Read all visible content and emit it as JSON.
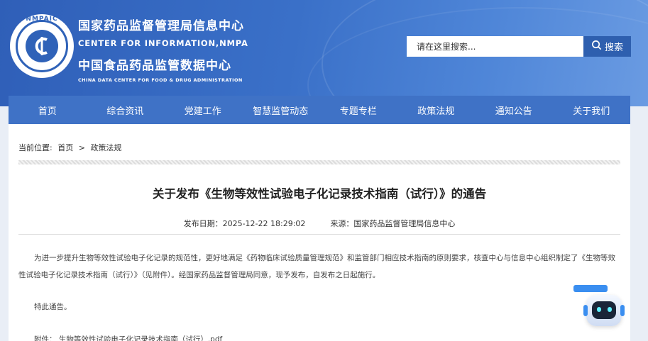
{
  "header": {
    "logo_text": "NMPAIC",
    "title_cn": "国家药品监督管理局信息中心",
    "title_en": "CENTER FOR INFORMATION,NMPA",
    "subtitle_cn": "中国食品药品监管数据中心",
    "subtitle_en": "CHINA DATA CENTER FOR FOOD & DRUG ADMINISTRATION"
  },
  "search": {
    "placeholder": "请在这里搜索...",
    "button_label": "搜索"
  },
  "nav": {
    "items": [
      {
        "label": "首页"
      },
      {
        "label": "综合资讯"
      },
      {
        "label": "党建工作"
      },
      {
        "label": "智慧监管动态"
      },
      {
        "label": "专题专栏"
      },
      {
        "label": "政策法规"
      },
      {
        "label": "通知公告"
      },
      {
        "label": "关于我们"
      }
    ]
  },
  "breadcrumb": {
    "prefix": "当前位置:",
    "home": "首页",
    "separator": ">",
    "current": "政策法规"
  },
  "article": {
    "title": "关于发布《生物等效性试验电子化记录技术指南（试行）》的通告",
    "date_label": "发布日期：",
    "date": "2025-12-22 18:29:02",
    "source_label": "来源：",
    "source": "国家药品监督管理局信息中心",
    "paragraph": "为进一步提升生物等效性试验电子化记录的规范性，更好地满足《药物临床试验质量管理规范》和监管部门相应技术指南的原则要求，核查中心与信息中心组织制定了《生物等效性试验电子化记录技术指南（试行）》（见附件）。经国家药品监督管理局同意，现予发布，自发布之日起施行。",
    "note": "特此通告。",
    "attachment": "附件：   生物等效性试验电子化记录技术指南（试行）.pdf"
  },
  "colors": {
    "header_bg": "#3a70c8",
    "nav_bg": "#3f72c6",
    "search_button": "#2e5faf"
  },
  "icons": {
    "search": "search-icon",
    "assistant": "robot-assistant-icon"
  }
}
